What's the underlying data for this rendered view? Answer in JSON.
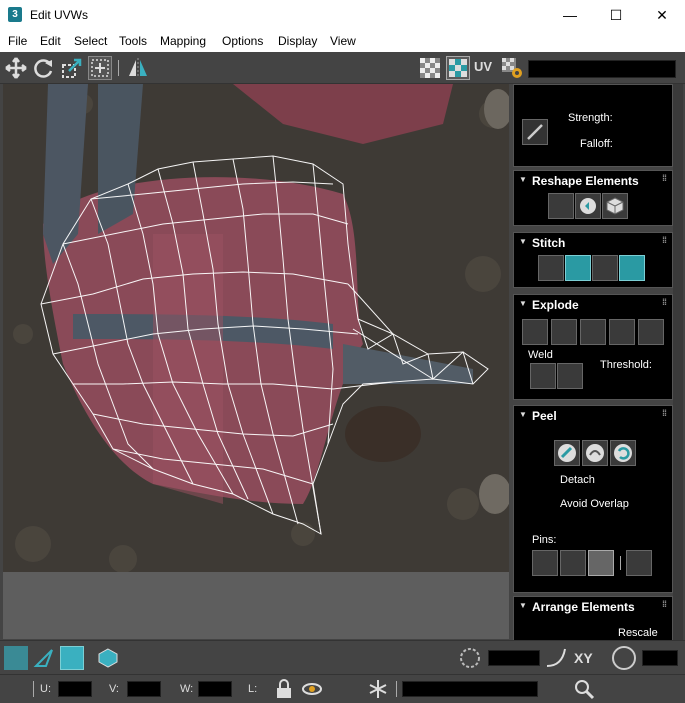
{
  "window": {
    "app_icon_glyph": "3",
    "title": "Edit UVWs",
    "minimize_glyph": "—",
    "maximize_glyph": "☐",
    "close_glyph": "✕"
  },
  "menu": [
    "File",
    "Edit",
    "Select",
    "Tools",
    "Mapping",
    "Options",
    "Display",
    "View"
  ],
  "toolbar": {
    "uv_label": "UV"
  },
  "panel": {
    "brush": {
      "strength_label": "Strength:",
      "falloff_label": "Falloff:"
    },
    "reshape": {
      "title": "Reshape Elements"
    },
    "stitch": {
      "title": "Stitch"
    },
    "explode": {
      "title": "Explode",
      "weld_label": "Weld",
      "threshold_label": "Threshold:"
    },
    "peel": {
      "title": "Peel",
      "detach_label": "Detach",
      "avoid_overlap_label": "Avoid Overlap",
      "pins_label": "Pins:"
    },
    "arrange": {
      "title": "Arrange Elements",
      "rescale_label": "Rescale"
    }
  },
  "bottom": {
    "xy_label": "XY",
    "u_label": "U:",
    "v_label": "V:",
    "w_label": "W:",
    "l_label": "L:"
  },
  "colors": {
    "accent_teal": "#2a9aa3",
    "panel_bg": "#000000",
    "ui_bg": "#444444"
  }
}
